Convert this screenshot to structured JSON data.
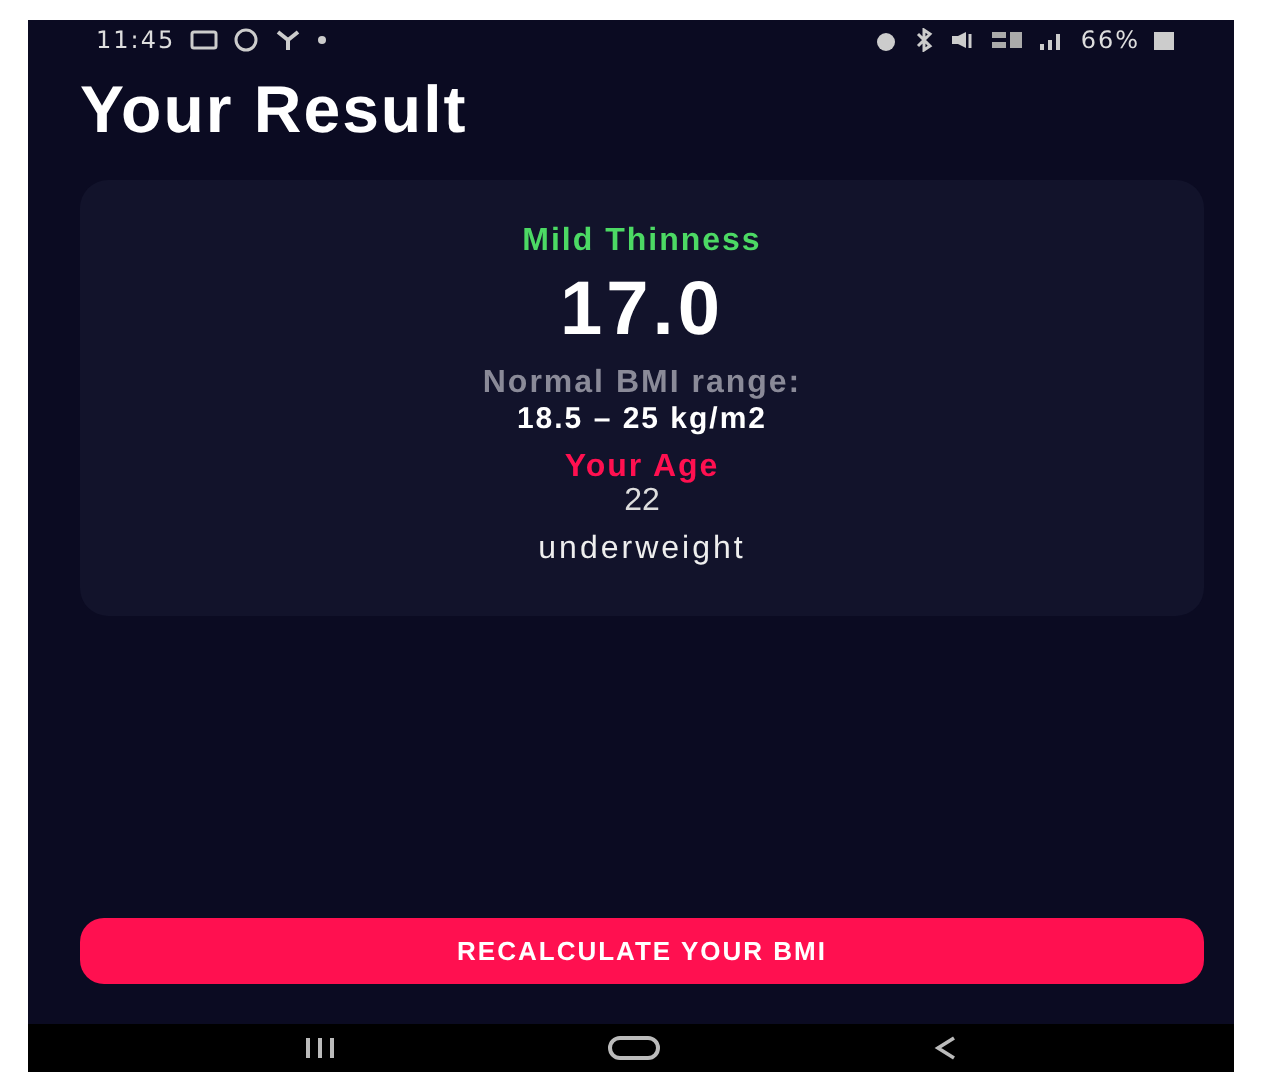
{
  "status_bar": {
    "time": "11:45",
    "battery": "66%"
  },
  "title": "Your Result",
  "result": {
    "category": "Mild Thinness",
    "bmi": "17.0",
    "range_label": "Normal BMI range:",
    "range_value": "18.5 – 25 kg/m2",
    "age_label": "Your Age",
    "age": "22",
    "interpretation": "underweight"
  },
  "button": "RECALCULATE YOUR BMI"
}
